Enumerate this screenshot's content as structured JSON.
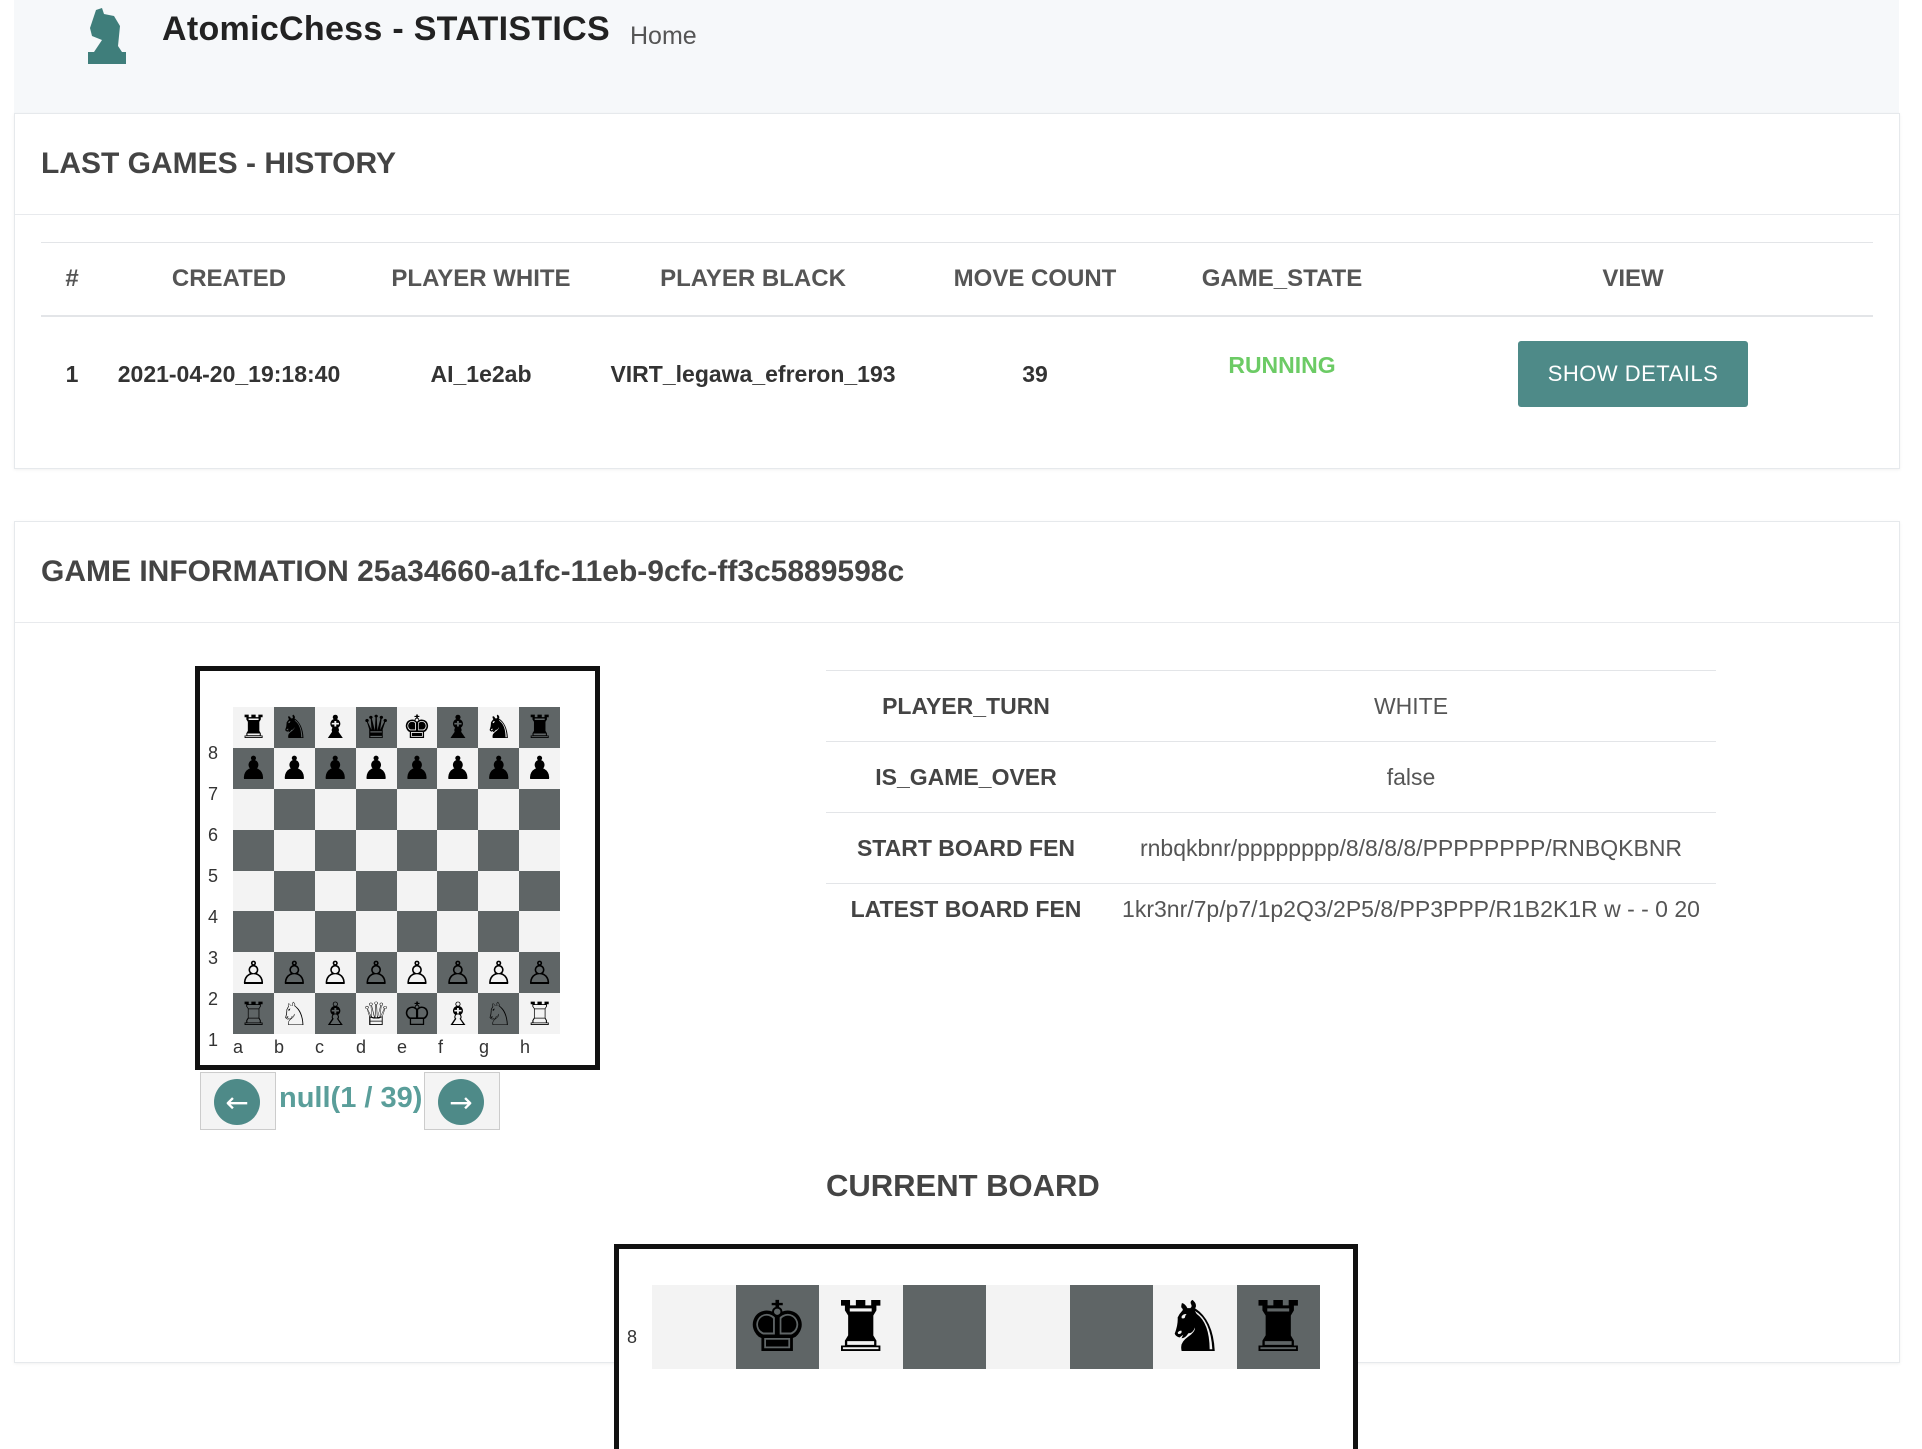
{
  "navbar": {
    "brand": "AtomicChess - STATISTICS",
    "home_link": "Home",
    "logo_icon": "knight-icon",
    "accent_color": "#3f7e7b"
  },
  "history": {
    "title": "LAST GAMES - HISTORY",
    "columns": [
      "#",
      "CREATED",
      "PLAYER WHITE",
      "PLAYER BLACK",
      "MOVE COUNT",
      "GAME_STATE",
      "VIEW"
    ],
    "rows": [
      {
        "index": "1",
        "created": "2021-04-20_19:18:40",
        "player_white": "AI_1e2ab",
        "player_black": "VIRT_legawa_efreron_193",
        "move_count": "39",
        "game_state": "RUNNING",
        "view_button": "SHOW DETAILS"
      }
    ],
    "colors": {
      "link": "#5a9e9a",
      "running": "#6ccb65",
      "button": "#4e8a88"
    }
  },
  "game_info": {
    "title": "GAME INFORMATION 25a34660-a1fc-11eb-9cfc-ff3c5889598c",
    "properties": [
      {
        "key": "PLAYER_TURN",
        "value": "WHITE"
      },
      {
        "key": "IS_GAME_OVER",
        "value": "false"
      },
      {
        "key": "START BOARD FEN",
        "value": "rnbqkbnr/pppppppp/8/8/8/8/PPPPPPPP/RNBQKBNR"
      },
      {
        "key": "LATEST BOARD FEN",
        "value": "1kr3nr/7p/p7/1p2Q3/2P5/8/PP3PPP/R1B2K1R w - - 0 20"
      }
    ],
    "move_counter": "null(1 / 39)",
    "prev_icon": "arrow-left-icon",
    "next_icon": "arrow-right-icon",
    "current_board_title": "CURRENT BOARD",
    "files": [
      "a",
      "b",
      "c",
      "d",
      "e",
      "f",
      "g",
      "h"
    ],
    "ranks": [
      "8",
      "7",
      "6",
      "5",
      "4",
      "3",
      "2",
      "1"
    ],
    "history_board": [
      [
        "♜",
        "♞",
        "♝",
        "♛",
        "♚",
        "♝",
        "♞",
        "♜"
      ],
      [
        "♟",
        "♟",
        "♟",
        "♟",
        "♟",
        "♟",
        "♟",
        "♟"
      ],
      [
        "",
        "",
        "",
        "",
        "",
        "",
        "",
        ""
      ],
      [
        "",
        "",
        "",
        "",
        "",
        "",
        "",
        ""
      ],
      [
        "",
        "",
        "",
        "",
        "",
        "",
        "",
        ""
      ],
      [
        "",
        "",
        "",
        "",
        "",
        "",
        "",
        ""
      ],
      [
        "♙",
        "♙",
        "♙",
        "♙",
        "♙",
        "♙",
        "♙",
        "♙"
      ],
      [
        "♖",
        "♘",
        "♗",
        "♕",
        "♔",
        "♗",
        "♘",
        "♖"
      ]
    ],
    "current_board_row8": [
      "",
      "♚",
      "♜",
      "",
      "",
      "",
      "♞",
      "♜"
    ]
  }
}
